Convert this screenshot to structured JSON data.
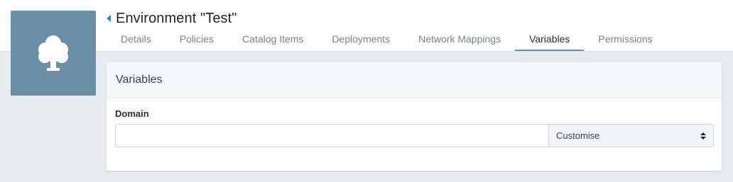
{
  "environment": {
    "icon": "tree-icon",
    "tile_color": "#6d8fa6",
    "title": "Environment \"Test\""
  },
  "tabs": [
    {
      "label": "Details",
      "active": false
    },
    {
      "label": "Policies",
      "active": false
    },
    {
      "label": "Catalog Items",
      "active": false
    },
    {
      "label": "Deployments",
      "active": false
    },
    {
      "label": "Network Mappings",
      "active": false
    },
    {
      "label": "Variables",
      "active": true
    },
    {
      "label": "Permissions",
      "active": false
    }
  ],
  "panel": {
    "title": "Variables",
    "field": {
      "label": "Domain",
      "value": "",
      "mode": "Customise"
    }
  }
}
